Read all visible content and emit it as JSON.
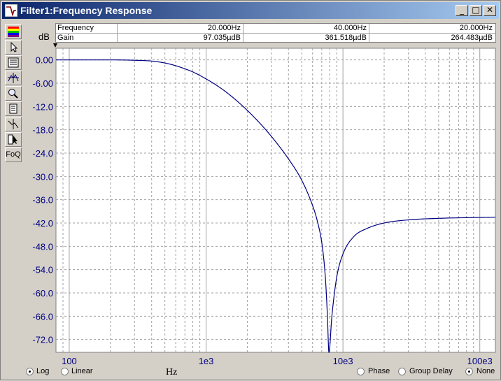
{
  "window": {
    "title": "Filter1:Frequency Response"
  },
  "title_buttons": [
    "_",
    "□",
    "✕"
  ],
  "toolbar": [
    "color-scale-icon",
    "pointer-icon",
    "list-icon",
    "cursor-icon",
    "zoom-icon",
    "document-icon",
    "marker-icon",
    "arrow-tool-icon",
    "FoQ"
  ],
  "readout": {
    "rows": [
      {
        "label": "Frequency",
        "v1": "20.000Hz",
        "v2": "40.000Hz",
        "v3": "20.000Hz"
      },
      {
        "label": "Gain",
        "v1": "97.035µdB",
        "v2": "361.518µdB",
        "v3": "264.483µdB"
      }
    ]
  },
  "scale_options": [
    {
      "label": "Log",
      "selected": true
    },
    {
      "label": "Linear",
      "selected": false
    }
  ],
  "plot_options": [
    {
      "label": "Phase",
      "selected": false
    },
    {
      "label": "Group Delay",
      "selected": false
    },
    {
      "label": "None",
      "selected": true
    }
  ],
  "colors": {
    "curve": "#000080",
    "axis_text": "#000080",
    "grid": "#a0a0a0",
    "plot_bg": "#ffffff"
  },
  "chart_data": {
    "type": "line",
    "xlabel": "Hz",
    "ylabel": "dB",
    "x_scale": "log",
    "xlim": [
      80,
      130000
    ],
    "ylim": [
      -75.3,
      3.0
    ],
    "grid": true,
    "x_ticks": [
      {
        "value": 100,
        "label": "100"
      },
      {
        "value": 1000,
        "label": "1e3"
      },
      {
        "value": 10000,
        "label": "10e3"
      },
      {
        "value": 100000,
        "label": "100e3"
      }
    ],
    "y_ticks": [
      {
        "value": 0,
        "label": "0.00"
      },
      {
        "value": -6,
        "label": "-6.00"
      },
      {
        "value": -12,
        "label": "-12.0"
      },
      {
        "value": -18,
        "label": "-18.0"
      },
      {
        "value": -24,
        "label": "-24.0"
      },
      {
        "value": -30,
        "label": "-30.0"
      },
      {
        "value": -36,
        "label": "-36.0"
      },
      {
        "value": -42,
        "label": "-42.0"
      },
      {
        "value": -48,
        "label": "-48.0"
      },
      {
        "value": -54,
        "label": "-54.0"
      },
      {
        "value": -60,
        "label": "-60.0"
      },
      {
        "value": -66,
        "label": "-66.0"
      },
      {
        "value": -72,
        "label": "-72.0"
      }
    ],
    "series": [
      {
        "x": [
          80,
          200,
          300,
          400,
          500,
          600,
          700,
          800,
          1000,
          1200,
          1500,
          2000,
          2500,
          3000,
          4000,
          5000,
          6000,
          6500,
          7000,
          7300,
          7500,
          7700,
          7900,
          8300,
          9000,
          10000,
          12000,
          15000,
          20000,
          30000,
          50000,
          130000
        ],
        "y": [
          0,
          0,
          -0.1,
          -0.3,
          -0.8,
          -1.5,
          -2.3,
          -3.1,
          -4.9,
          -6.6,
          -9.1,
          -13.0,
          -16.5,
          -19.7,
          -25.5,
          -31.0,
          -37.5,
          -41.5,
          -47.0,
          -52.5,
          -58.0,
          -66.0,
          -75.3,
          -66.0,
          -56.0,
          -50.0,
          -45.5,
          -43.4,
          -42.0,
          -41.2,
          -40.8,
          -40.5
        ]
      }
    ]
  }
}
